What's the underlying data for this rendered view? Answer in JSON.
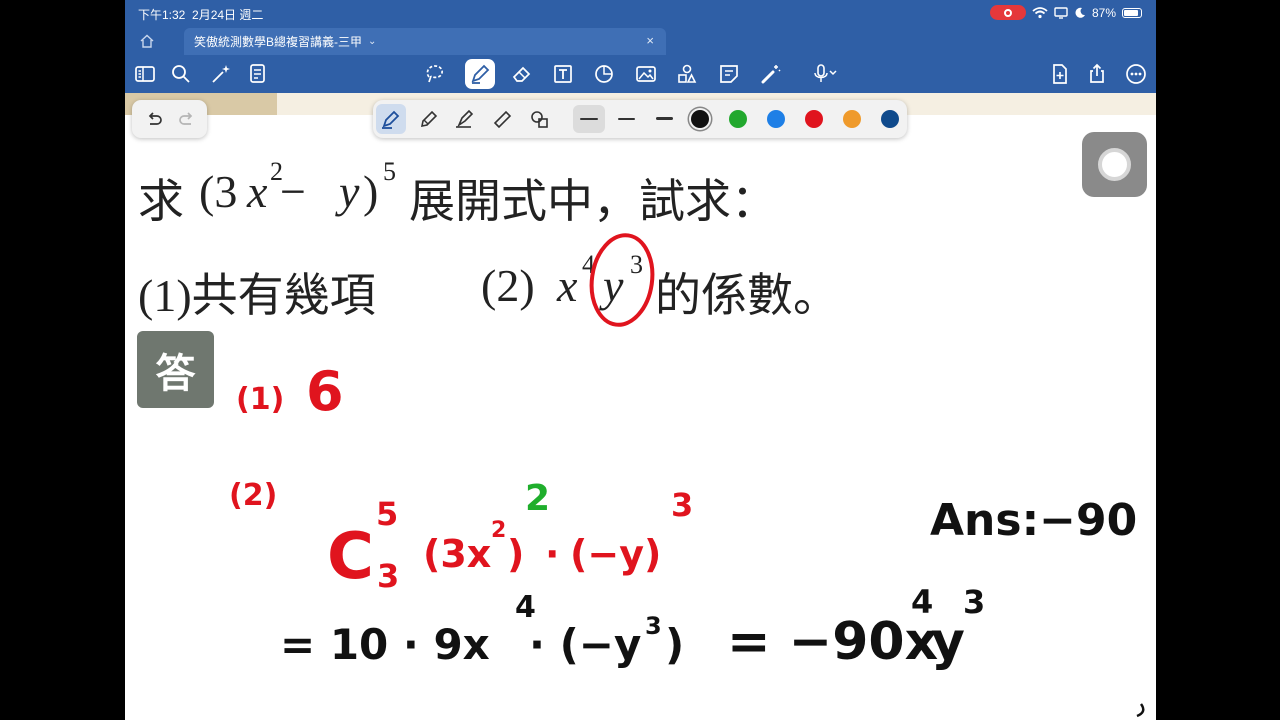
{
  "status": {
    "time": "下午1:32",
    "date": "2月24日 週二",
    "battery": "87%"
  },
  "tab": {
    "title": "笑傲統測數學B總複習講義-三甲",
    "chevron": "⌄",
    "close": "×"
  },
  "question": {
    "line1_prefix": "求",
    "expr_open": "(3",
    "expr_x": "x",
    "exp_x": "2",
    "expr_minus": " − ",
    "expr_y": "y",
    "expr_close": ")",
    "exp_outer": "5",
    "line1_suffix": "展開式中，試求：",
    "part1": "(1)共有幾項",
    "part2_label": "(2)",
    "part2_x": "x",
    "part2_xexp": "4",
    "part2_y": "y",
    "part2_yexp": "3",
    "part2_suffix": "的係數。"
  },
  "answer_badge": "答",
  "handwriting": {
    "p1_label": "(1)",
    "p1_value": "6",
    "p2_label": "(2)",
    "c_letter": "C",
    "c_top": "5",
    "c_bottom": "3",
    "term1": "(3x",
    "term1_inner_exp": "2",
    "term1_close": ")",
    "term1_outer_exp": "2",
    "dot": "·",
    "term2": "(−y)",
    "term2_exp": "3",
    "line2": "= 10 · 9x",
    "line2_exp": "4",
    "line2_mid": "· (−y",
    "line2_mid_exp": "3",
    "line2_close": ")",
    "line2_result": "= −90x",
    "line2_result_xexp": "4",
    "line2_result_y": "y",
    "line2_result_yexp": "3",
    "final_answer": "Ans:−90"
  },
  "colors": {
    "toolbar_blue": "#2f5fa6",
    "ink_red": "#e0141e",
    "ink_green": "#1fae2c",
    "ink_black": "#111111",
    "swatches": [
      "#111111",
      "#22a82e",
      "#1e7fe6",
      "#e0141e",
      "#ef9a2b",
      "#0f4a8c"
    ]
  },
  "icons": {
    "toolbar": [
      "sidebar-icon",
      "search-icon",
      "magic-icon",
      "document-list-icon",
      "lasso-icon",
      "pen-icon",
      "eraser-icon",
      "text-box-icon",
      "shapes-icon",
      "image-icon",
      "elements-icon",
      "sticky-note-icon",
      "laser-pointer-icon",
      "microphone-icon",
      "add-page-icon",
      "share-icon",
      "more-icon"
    ]
  }
}
